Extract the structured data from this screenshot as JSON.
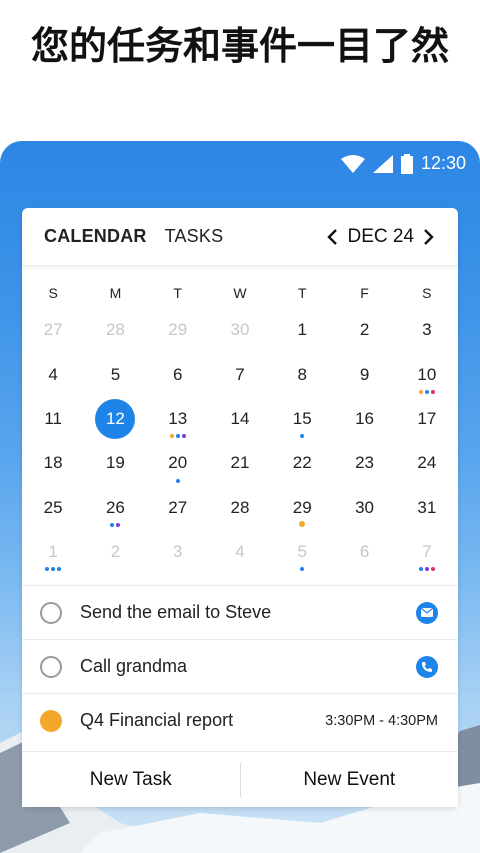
{
  "headline": "您的任务和事件一目了然",
  "status_bar": {
    "time": "12:30"
  },
  "header": {
    "tabs": [
      "CALENDAR",
      "TASKS"
    ],
    "month": "DEC 24"
  },
  "weekdays": [
    "S",
    "M",
    "T",
    "W",
    "T",
    "F",
    "S"
  ],
  "weeks": [
    [
      {
        "d": "27",
        "m": true
      },
      {
        "d": "28",
        "m": true
      },
      {
        "d": "29",
        "m": true
      },
      {
        "d": "30",
        "m": true
      },
      {
        "d": "1"
      },
      {
        "d": "2"
      },
      {
        "d": "3"
      }
    ],
    [
      {
        "d": "4"
      },
      {
        "d": "5"
      },
      {
        "d": "6"
      },
      {
        "d": "7"
      },
      {
        "d": "8"
      },
      {
        "d": "9"
      },
      {
        "d": "10",
        "dots": [
          "#f4a82b",
          "#1f84e8",
          "#e0306a"
        ]
      }
    ],
    [
      {
        "d": "11"
      },
      {
        "d": "12",
        "today": true
      },
      {
        "d": "13",
        "dots": [
          "#f4a82b",
          "#1f84e8",
          "#7a3ae0"
        ]
      },
      {
        "d": "14"
      },
      {
        "d": "15",
        "dots": [
          "#1f84e8"
        ]
      },
      {
        "d": "16"
      },
      {
        "d": "17"
      }
    ],
    [
      {
        "d": "18"
      },
      {
        "d": "19"
      },
      {
        "d": "20",
        "dots": [
          "#1f84e8"
        ]
      },
      {
        "d": "21"
      },
      {
        "d": "22"
      },
      {
        "d": "23"
      },
      {
        "d": "24"
      }
    ],
    [
      {
        "d": "25"
      },
      {
        "d": "26",
        "dots": [
          "#1f84e8",
          "#7a3ae0"
        ]
      },
      {
        "d": "27"
      },
      {
        "d": "28"
      },
      {
        "d": "29",
        "dots": [
          "#f4a82b"
        ]
      },
      {
        "d": "30"
      },
      {
        "d": "31"
      }
    ],
    [
      {
        "d": "1",
        "m": true,
        "dots": [
          "#1f84e8",
          "#1f84e8",
          "#1f84e8"
        ]
      },
      {
        "d": "2",
        "m": true
      },
      {
        "d": "3",
        "m": true
      },
      {
        "d": "4",
        "m": true
      },
      {
        "d": "5",
        "m": true,
        "dots": [
          "#1f84e8"
        ]
      },
      {
        "d": "6",
        "m": true
      },
      {
        "d": "7",
        "m": true,
        "dots": [
          "#1f84e8",
          "#7a3ae0",
          "#e0306a"
        ]
      }
    ]
  ],
  "tasks": [
    {
      "label": "Send the email to Steve",
      "icon": "mail-icon"
    },
    {
      "label": "Call grandma",
      "icon": "phone-icon"
    },
    {
      "label": "Q4 Financial report",
      "time": "3:30PM - 4:30PM"
    }
  ],
  "actions": {
    "new_task": "New Task",
    "new_event": "New Event"
  },
  "colors": {
    "accent": "#1f84e8",
    "event_orange": "#f4a82b"
  }
}
